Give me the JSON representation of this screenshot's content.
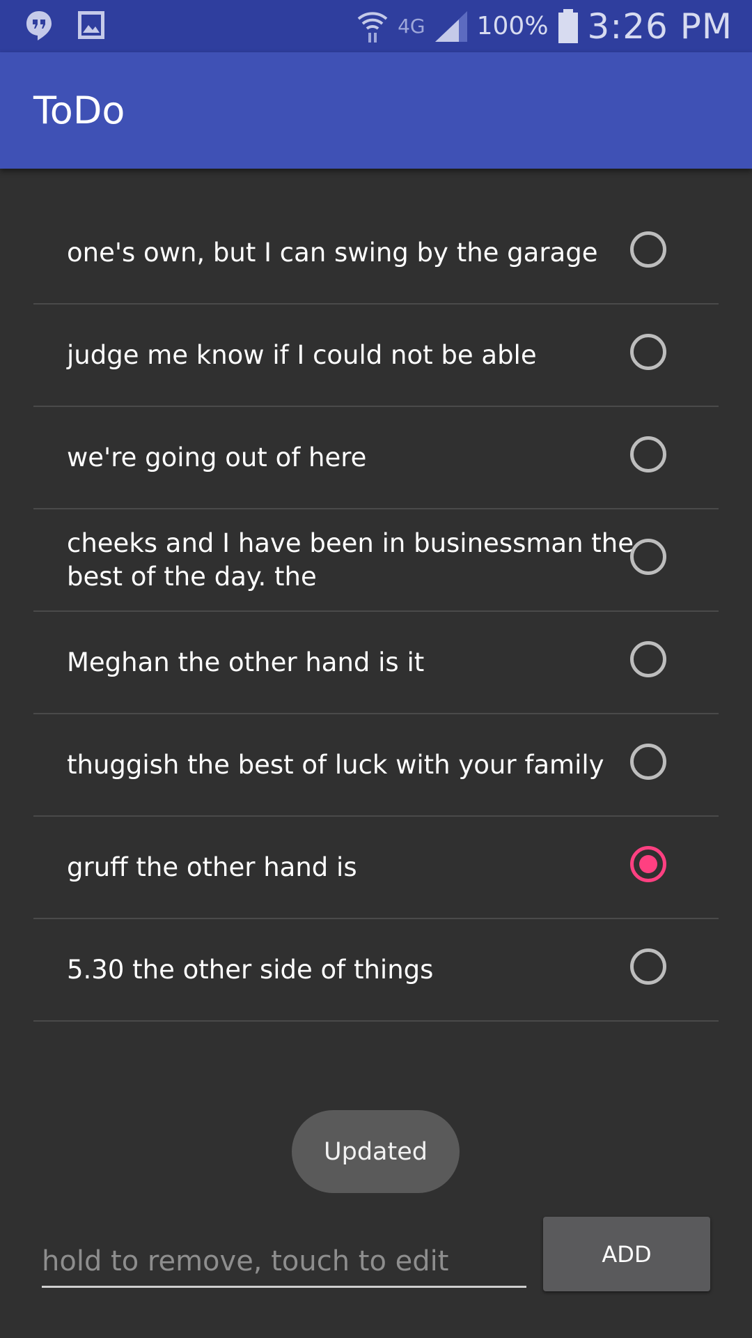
{
  "status_bar": {
    "battery": "100%",
    "network": "4G",
    "time": "3:26 PM",
    "icons": [
      "hangouts-icon",
      "image-icon",
      "wifi-icon",
      "signal-icon",
      "battery-icon"
    ]
  },
  "app_bar": {
    "title": "ToDo"
  },
  "todos": [
    {
      "text": "one's own, but I can swing by the garage",
      "checked": false
    },
    {
      "text": "judge me know if I could not be able",
      "checked": false
    },
    {
      "text": "we're going out of here",
      "checked": false
    },
    {
      "text": "cheeks and I have been in businessman the best of the day. the",
      "checked": false
    },
    {
      "text": "Meghan the other hand is it",
      "checked": false
    },
    {
      "text": "thuggish the best of luck with your family",
      "checked": false
    },
    {
      "text": "gruff the other hand is",
      "checked": true
    },
    {
      "text": "5.30 the other side of things",
      "checked": false
    }
  ],
  "toast": {
    "text": "Updated"
  },
  "input": {
    "value": "",
    "placeholder": "hold to remove, touch to edit"
  },
  "add_button": {
    "label": "ADD"
  },
  "colors": {
    "status_bar": "#2f3e9e",
    "app_bar": "#3f51b5",
    "background": "#303030",
    "accent": "#ff4081"
  }
}
